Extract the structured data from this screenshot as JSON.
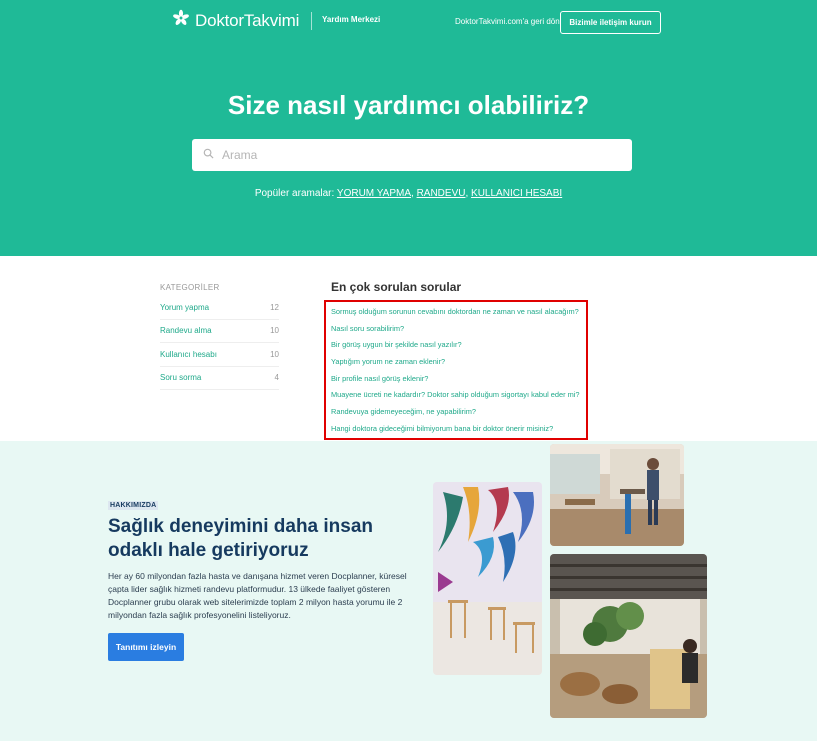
{
  "header": {
    "brand": "DoktorTakvimi",
    "help_center": "Yardım Merkezi",
    "back_link": "DoktorTakvimi.com'a geri dön",
    "contact_button": "Bizimle iletişim kurun"
  },
  "hero": {
    "title": "Size nasıl yardımcı olabiliriz?",
    "search_placeholder": "Arama",
    "popular_label": "Popüler aramalar:",
    "popular_links": [
      "YORUM YAPMA",
      "RANDEVU",
      "KULLANICI HESABI"
    ]
  },
  "categories": {
    "heading": "KATEGORİLER",
    "items": [
      {
        "label": "Yorum yapma",
        "count": "12"
      },
      {
        "label": "Randevu alma",
        "count": "10"
      },
      {
        "label": "Kullanıcı hesabı",
        "count": "10"
      },
      {
        "label": "Soru sorma",
        "count": "4"
      }
    ]
  },
  "faq": {
    "title": "En çok sorulan sorular",
    "items": [
      "Sormuş olduğum sorunun cevabını doktordan ne zaman ve nasıl alacağım?",
      "Nasıl soru sorabilirim?",
      "Bir görüş uygun bir şekilde nasıl yazılır?",
      "Yaptığım yorum ne zaman eklenir?",
      "Bir profile nasıl görüş eklenir?",
      "Muayene ücreti ne kadardır? Doktor sahip olduğum sigortayı kabul eder mi?",
      "Randevuya gidemeyeceğim, ne yapabilirim?",
      "Hangi doktora gideceğimi bilmiyorum bana bir doktor önerir misiniz?"
    ]
  },
  "about": {
    "badge": "HAKKIMIZDA",
    "title": "Sağlık deneyimini daha insan odaklı hale getiriyoruz",
    "text": "Her ay 60 milyondan fazla hasta ve danışana hizmet veren Docplanner, küresel çapta lider sağlık hizmeti randevu platformudur. 13 ülkede faaliyet gösteren Docplanner grubu olarak web sitelerimizde toplam 2 milyon hasta yorumu ile 2 milyondan fazla sağlık profesyonelini listeliyoruz.",
    "button": "Tanıtımı izleyin"
  },
  "colors": {
    "brand": "#1fba97",
    "link": "#1fa98a",
    "highlight": "#e00000",
    "navy": "#163a5f",
    "button_blue": "#2a7de1"
  }
}
